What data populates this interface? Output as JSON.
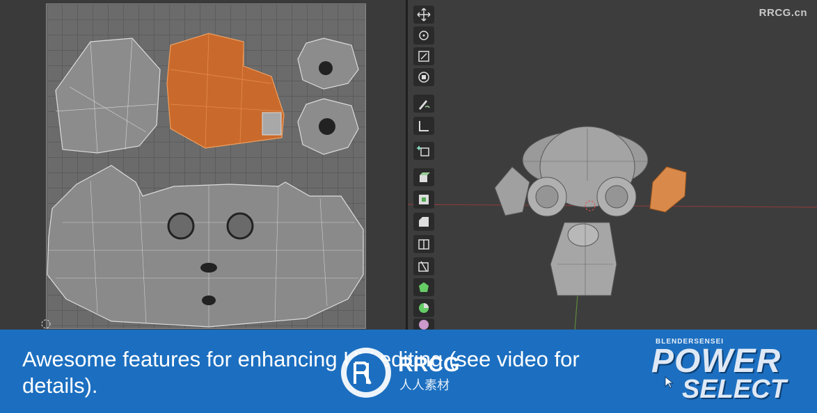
{
  "watermark": "RRCG.cn",
  "caption": "Awesome features for enhancing UV editing (see video for details).",
  "center_logo": {
    "text": "RRCG",
    "subtext": "人人素材"
  },
  "brand": {
    "small": "BLENDERSENSEI",
    "line1": "POWER",
    "line2": "SELECT"
  },
  "toolbar_icons": [
    "move-icon",
    "rotate-icon",
    "scale-icon",
    "transform-icon",
    "annotate-icon",
    "measure-icon",
    "add-cube-icon",
    "extrude-icon",
    "inset-icon",
    "bevel-icon",
    "loop-cut-icon",
    "knife-icon",
    "poly-build-icon",
    "spin-icon",
    "smooth-icon"
  ],
  "colors": {
    "caption_bg": "#1c6fc0",
    "selection": "#d2712e",
    "uv_grid": "#6b6b6b",
    "viewport_bg": "#3d3d3d"
  }
}
